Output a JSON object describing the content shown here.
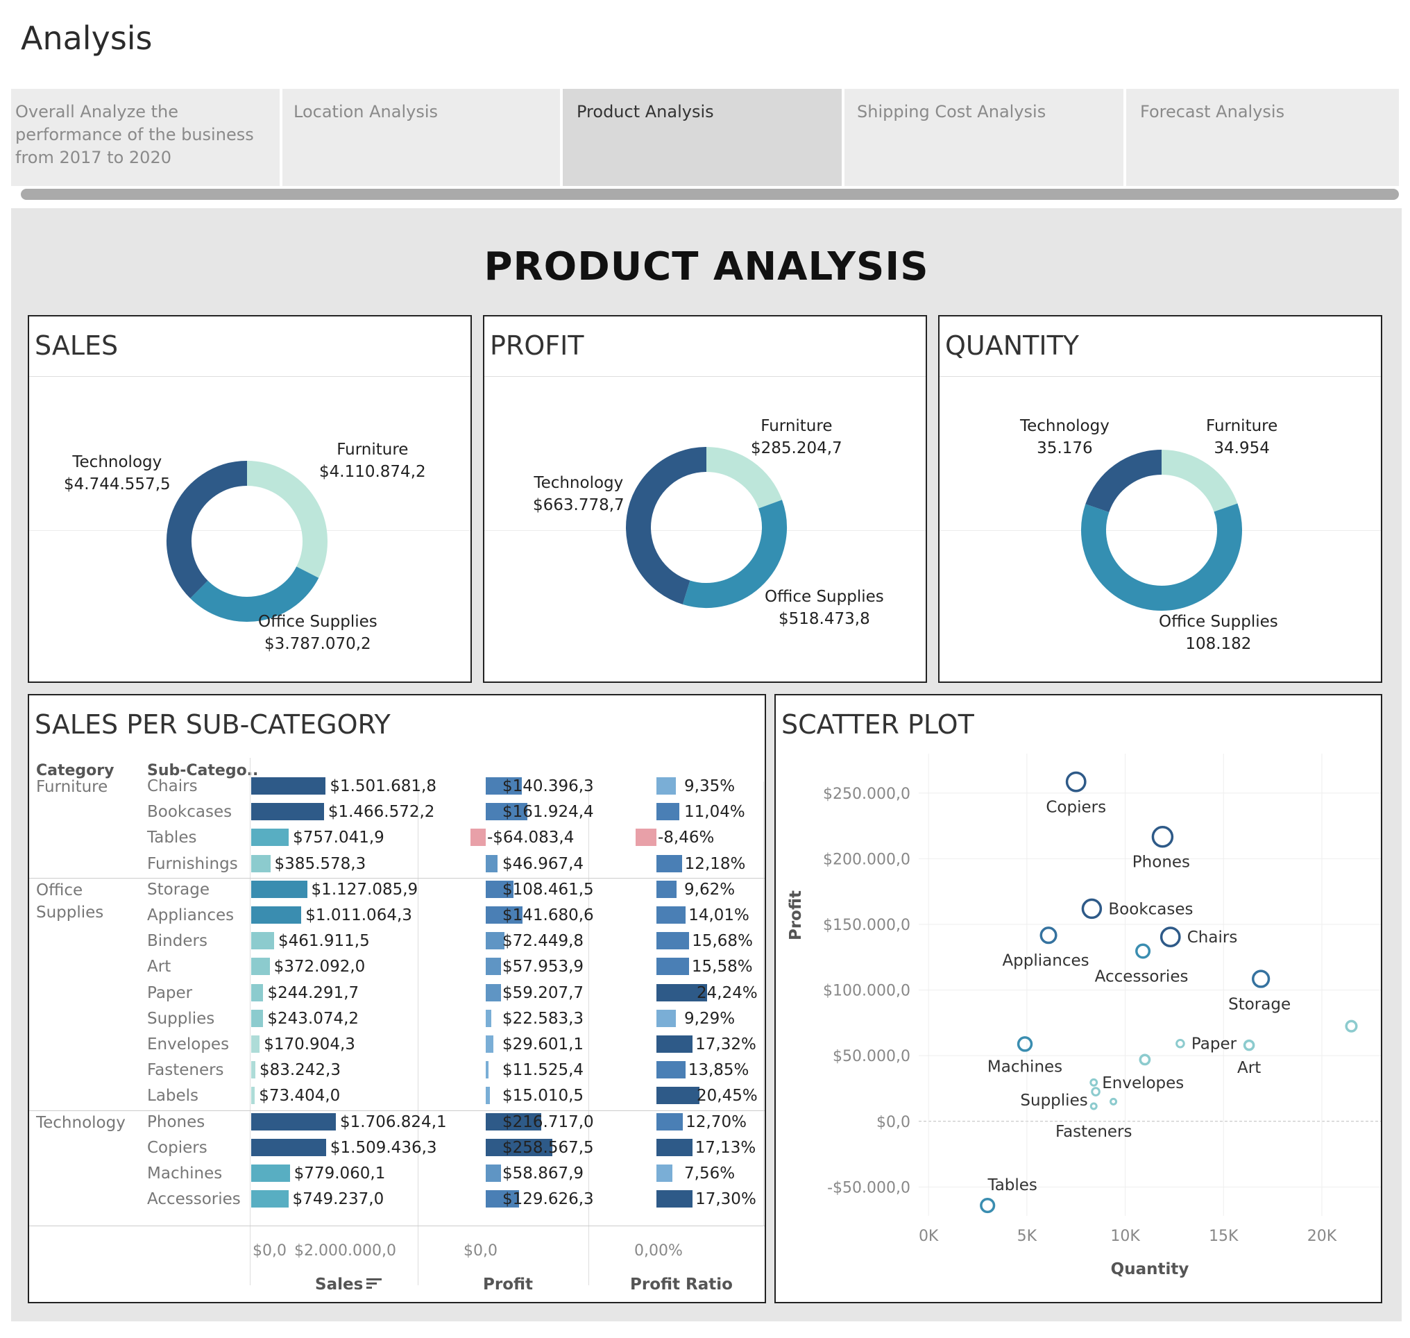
{
  "app": {
    "title": "Analysis"
  },
  "tabs": [
    {
      "label": "Overall Analyze the\nperformance of the business\nfrom 2017 to 2020",
      "active": false
    },
    {
      "label": "Location Analysis",
      "active": false
    },
    {
      "label": "Product Analysis",
      "active": true
    },
    {
      "label": "Shipping Cost Analysis",
      "active": false
    },
    {
      "label": "Forecast Analysis",
      "active": false
    }
  ],
  "dashboard": {
    "title": "PRODUCT ANALYSIS"
  },
  "colors": {
    "furniture": "#bde6da",
    "office_supplies": "#348fb2",
    "technology": "#2e5a88"
  },
  "donuts": {
    "sales": {
      "title": "SALES",
      "segments": [
        {
          "name": "Furniture",
          "value_label": "$4.110.874,2",
          "value": 4110874.2
        },
        {
          "name": "Office Supplies",
          "value_label": "$3.787.070,2",
          "value": 3787070.2
        },
        {
          "name": "Technology",
          "value_label": "$4.744.557,5",
          "value": 4744557.5
        }
      ]
    },
    "profit": {
      "title": "PROFIT",
      "segments": [
        {
          "name": "Furniture",
          "value_label": "$285.204,7",
          "value": 285204.7
        },
        {
          "name": "Office Supplies",
          "value_label": "$518.473,8",
          "value": 518473.8
        },
        {
          "name": "Technology",
          "value_label": "$663.778,7",
          "value": 663778.7
        }
      ]
    },
    "quantity": {
      "title": "QUANTITY",
      "segments": [
        {
          "name": "Furniture",
          "value_label": "34.954",
          "value": 34954
        },
        {
          "name": "Office Supplies",
          "value_label": "108.182",
          "value": 108182
        },
        {
          "name": "Technology",
          "value_label": "35.176",
          "value": 35176
        }
      ]
    }
  },
  "subcategory": {
    "title": "SALES PER SUB-CATEGORY",
    "headers": {
      "category": "Category",
      "subcategory": "Sub-Catego.."
    },
    "groups": [
      {
        "category": "Furniture",
        "rows": [
          {
            "name": "Chairs",
            "sales": 1501681.8,
            "sales_label": "$1.501.681,8",
            "profit": 140396.3,
            "profit_label": "$140.396,3",
            "ratio": 9.35,
            "ratio_label": "9,35%"
          },
          {
            "name": "Bookcases",
            "sales": 1466572.2,
            "sales_label": "$1.466.572,2",
            "profit": 161924.4,
            "profit_label": "$161.924,4",
            "ratio": 11.04,
            "ratio_label": "11,04%"
          },
          {
            "name": "Tables",
            "sales": 757041.9,
            "sales_label": "$757.041,9",
            "profit": -64083.4,
            "profit_label": "-$64.083,4",
            "ratio": -8.46,
            "ratio_label": "-8,46%"
          },
          {
            "name": "Furnishings",
            "sales": 385578.3,
            "sales_label": "$385.578,3",
            "profit": 46967.4,
            "profit_label": "$46.967,4",
            "ratio": 12.18,
            "ratio_label": "12,18%"
          }
        ]
      },
      {
        "category": "Office\nSupplies",
        "rows": [
          {
            "name": "Storage",
            "sales": 1127085.9,
            "sales_label": "$1.127.085,9",
            "profit": 108461.5,
            "profit_label": "$108.461,5",
            "ratio": 9.62,
            "ratio_label": "9,62%"
          },
          {
            "name": "Appliances",
            "sales": 1011064.3,
            "sales_label": "$1.011.064,3",
            "profit": 141680.6,
            "profit_label": "$141.680,6",
            "ratio": 14.01,
            "ratio_label": "14,01%"
          },
          {
            "name": "Binders",
            "sales": 461911.5,
            "sales_label": "$461.911,5",
            "profit": 72449.8,
            "profit_label": "$72.449,8",
            "ratio": 15.68,
            "ratio_label": "15,68%"
          },
          {
            "name": "Art",
            "sales": 372092.0,
            "sales_label": "$372.092,0",
            "profit": 57953.9,
            "profit_label": "$57.953,9",
            "ratio": 15.58,
            "ratio_label": "15,58%"
          },
          {
            "name": "Paper",
            "sales": 244291.7,
            "sales_label": "$244.291,7",
            "profit": 59207.7,
            "profit_label": "$59.207,7",
            "ratio": 24.24,
            "ratio_label": "24,24%"
          },
          {
            "name": "Supplies",
            "sales": 243074.2,
            "sales_label": "$243.074,2",
            "profit": 22583.3,
            "profit_label": "$22.583,3",
            "ratio": 9.29,
            "ratio_label": "9,29%"
          },
          {
            "name": "Envelopes",
            "sales": 170904.3,
            "sales_label": "$170.904,3",
            "profit": 29601.1,
            "profit_label": "$29.601,1",
            "ratio": 17.32,
            "ratio_label": "17,32%"
          },
          {
            "name": "Fasteners",
            "sales": 83242.3,
            "sales_label": "$83.242,3",
            "profit": 11525.4,
            "profit_label": "$11.525,4",
            "ratio": 13.85,
            "ratio_label": "13,85%"
          },
          {
            "name": "Labels",
            "sales": 73404.0,
            "sales_label": "$73.404,0",
            "profit": 15010.5,
            "profit_label": "$15.010,5",
            "ratio": 20.45,
            "ratio_label": "20,45%"
          }
        ]
      },
      {
        "category": "Technology",
        "rows": [
          {
            "name": "Phones",
            "sales": 1706824.1,
            "sales_label": "$1.706.824,1",
            "profit": 216717.0,
            "profit_label": "$216.717,0",
            "ratio": 12.7,
            "ratio_label": "12,70%"
          },
          {
            "name": "Copiers",
            "sales": 1509436.3,
            "sales_label": "$1.509.436,3",
            "profit": 258567.5,
            "profit_label": "$258.567,5",
            "ratio": 17.13,
            "ratio_label": "17,13%"
          },
          {
            "name": "Machines",
            "sales": 779060.1,
            "sales_label": "$779.060,1",
            "profit": 58867.9,
            "profit_label": "$58.867,9",
            "ratio": 7.56,
            "ratio_label": "7,56%"
          },
          {
            "name": "Accessories",
            "sales": 749237.0,
            "sales_label": "$749.237,0",
            "profit": 129626.3,
            "profit_label": "$129.626,3",
            "ratio": 17.3,
            "ratio_label": "17,30%"
          }
        ]
      }
    ],
    "axis": {
      "sales_ticks": [
        "$0,0",
        "$2.000.000,0"
      ],
      "profit_ticks": [
        "$0,0"
      ],
      "ratio_ticks": [
        "0,00%"
      ],
      "sales_title": "Sales",
      "profit_title": "Profit",
      "ratio_title": "Profit Ratio"
    }
  },
  "chart_data": {
    "type": "scatter",
    "title": "SCATTER PLOT",
    "xlabel": "Quantity",
    "ylabel": "Profit",
    "xlim": [
      -500,
      23000
    ],
    "ylim": [
      -72000,
      280000
    ],
    "x_ticks": [
      "0K",
      "5K",
      "10K",
      "15K",
      "20K"
    ],
    "y_ticks": [
      "$250.000,0",
      "$200.000,0",
      "$150.000,0",
      "$100.000,0",
      "$50.000,0",
      "$0,0",
      "-$50.000,0"
    ],
    "points": [
      {
        "label": "Copiers",
        "x": 7500,
        "y": 258567.5,
        "size": 1509436.3
      },
      {
        "label": "Phones",
        "x": 11900,
        "y": 216717.0,
        "size": 1706824.1
      },
      {
        "label": "Bookcases",
        "x": 8300,
        "y": 161924.4,
        "size": 1466572.2
      },
      {
        "label": "Appliances",
        "x": 6100,
        "y": 141680.6,
        "size": 1011064.3
      },
      {
        "label": "Chairs",
        "x": 12300,
        "y": 140396.3,
        "size": 1501681.8
      },
      {
        "label": "Accessories",
        "x": 10900,
        "y": 129626.3,
        "size": 749237.0
      },
      {
        "label": "Storage",
        "x": 16900,
        "y": 108461.5,
        "size": 1127085.9
      },
      {
        "label": "",
        "x": 21500,
        "y": 72449.8,
        "size": 461911.5
      },
      {
        "label": "Machines",
        "x": 4900,
        "y": 58867.9,
        "size": 779060.1
      },
      {
        "label": "Paper",
        "x": 12800,
        "y": 59207.7,
        "size": 244291.7
      },
      {
        "label": "Art",
        "x": 16300,
        "y": 57953.9,
        "size": 372092.0
      },
      {
        "label": "",
        "x": 11000,
        "y": 46967.4,
        "size": 385578.3
      },
      {
        "label": "Envelopes",
        "x": 8400,
        "y": 29601.1,
        "size": 170904.3
      },
      {
        "label": "Supplies",
        "x": 8500,
        "y": 22583.3,
        "size": 243074.2
      },
      {
        "label": "Fasteners",
        "x": 8400,
        "y": 11525.4,
        "size": 83242.3
      },
      {
        "label": "",
        "x": 9400,
        "y": 15010.5,
        "size": 73404.0
      },
      {
        "label": "Tables",
        "x": 3000,
        "y": -64083.4,
        "size": 757041.9
      }
    ]
  }
}
